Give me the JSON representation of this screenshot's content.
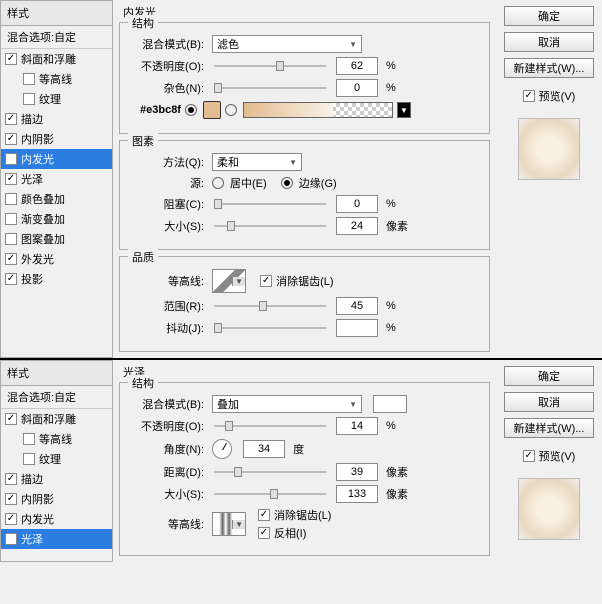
{
  "panels": [
    {
      "title": "内发光",
      "hex": "#e3bc8f",
      "styles": {
        "header": "样式",
        "sub": "混合选项:自定",
        "items": [
          {
            "label": "斜面和浮雕",
            "on": true
          },
          {
            "label": "等高线",
            "on": false,
            "indent": true
          },
          {
            "label": "纹理",
            "on": false,
            "indent": true
          },
          {
            "label": "描边",
            "on": true
          },
          {
            "label": "内阴影",
            "on": true
          },
          {
            "label": "内发光",
            "on": true,
            "sel": true
          },
          {
            "label": "光泽",
            "on": true
          },
          {
            "label": "颜色叠加",
            "on": false
          },
          {
            "label": "渐变叠加",
            "on": false
          },
          {
            "label": "图案叠加",
            "on": false
          },
          {
            "label": "外发光",
            "on": true
          },
          {
            "label": "投影",
            "on": true
          }
        ]
      },
      "struct": {
        "legend": "结构",
        "blendMode": "混合模式(B):",
        "blendModeVal": "滤色",
        "opacity": "不透明度(O):",
        "opacityVal": "62",
        "noise": "杂色(N):",
        "noiseVal": "0",
        "pct": "%"
      },
      "elem": {
        "legend": "图素",
        "method": "方法(Q):",
        "methodVal": "柔和",
        "source": "源:",
        "srcCenter": "居中(E)",
        "srcEdge": "边缘(G)",
        "choke": "阻塞(C):",
        "chokeVal": "0",
        "size": "大小(S):",
        "sizeVal": "24",
        "px": "像素"
      },
      "quality": {
        "legend": "品质",
        "contour": "等高线:",
        "anti": "消除锯齿(L)",
        "range": "范围(R):",
        "rangeVal": "45",
        "jitter": "抖动(J):",
        "jitterVal": ""
      },
      "buttons": {
        "ok": "确定",
        "cancel": "取消",
        "newStyle": "新建样式(W)...",
        "preview": "预览(V)"
      }
    },
    {
      "title": "光泽",
      "styles": {
        "header": "样式",
        "sub": "混合选项:自定",
        "items": [
          {
            "label": "斜面和浮雕",
            "on": true
          },
          {
            "label": "等高线",
            "on": false,
            "indent": true
          },
          {
            "label": "纹理",
            "on": false,
            "indent": true
          },
          {
            "label": "描边",
            "on": true
          },
          {
            "label": "内阴影",
            "on": true
          },
          {
            "label": "内发光",
            "on": true
          },
          {
            "label": "光泽",
            "on": true,
            "sel": true
          }
        ]
      },
      "struct": {
        "legend": "结构",
        "blendMode": "混合模式(B):",
        "blendModeVal": "叠加",
        "opacity": "不透明度(O):",
        "opacityVal": "14",
        "angle": "角度(N):",
        "angleVal": "34",
        "deg": "度",
        "dist": "距离(D):",
        "distVal": "39",
        "size": "大小(S):",
        "sizeVal": "133",
        "px": "像素",
        "contour": "等高线:",
        "anti": "消除锯齿(L)",
        "invert": "反相(I)",
        "pct": "%"
      },
      "buttons": {
        "ok": "确定",
        "cancel": "取消",
        "newStyle": "新建样式(W)...",
        "preview": "预览(V)"
      }
    }
  ]
}
